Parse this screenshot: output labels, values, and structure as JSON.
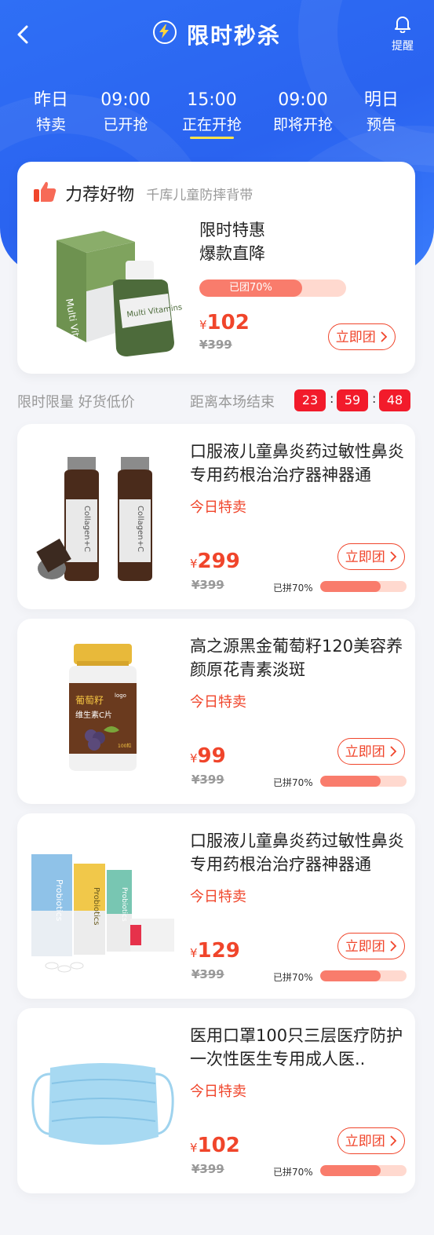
{
  "header": {
    "title": "限时秒杀",
    "remind_label": "提醒"
  },
  "tabs": [
    {
      "line1": "昨日",
      "line2": "特卖",
      "active": false
    },
    {
      "line1": "09:00",
      "line2": "已开抢",
      "active": false
    },
    {
      "line1": "15:00",
      "line2": "正在开抢",
      "active": true
    },
    {
      "line1": "09:00",
      "line2": "即将开抢",
      "active": false
    },
    {
      "line1": "明日",
      "line2": "预告",
      "active": false
    }
  ],
  "featured": {
    "title": "力荐好物",
    "subtitle": "千库儿童防摔背带",
    "slogan_line1": "限时特惠",
    "slogan_line2": "爆款直降",
    "progress_label": "已团70%",
    "progress": 0.7,
    "currency": "¥",
    "price": "102",
    "original_price": "¥399",
    "button": "立即团",
    "image_text": "Multi Vitamins"
  },
  "countdown": {
    "left_text": "限时限量 好货低价",
    "mid_text": "距离本场结束",
    "hours": "23",
    "minutes": "59",
    "seconds": "48",
    "separator": ":"
  },
  "products": [
    {
      "title": "口服液儿童鼻炎药过敏性鼻炎专用药根治治疗器神器通",
      "tag": "今日特卖",
      "currency": "¥",
      "price": "299",
      "original_price": "¥399",
      "button": "立即团",
      "sold_label": "已拼70%",
      "progress": 0.7,
      "image_text": "Collagen+C"
    },
    {
      "title": "高之源黑金葡萄籽120美容养颜原花青素淡斑",
      "tag": "今日特卖",
      "currency": "¥",
      "price": "99",
      "original_price": "¥399",
      "button": "立即团",
      "sold_label": "已拼70%",
      "progress": 0.7,
      "image_text_1": "葡萄籽",
      "image_text_2": "维生素C片",
      "image_text_3": "logo",
      "image_text_4": "100粒"
    },
    {
      "title": "口服液儿童鼻炎药过敏性鼻炎专用药根治治疗器神器通",
      "tag": "今日特卖",
      "currency": "¥",
      "price": "129",
      "original_price": "¥399",
      "button": "立即团",
      "sold_label": "已拼70%",
      "progress": 0.7,
      "image_text": "Probiotics"
    },
    {
      "title": "医用口罩100只三层医疗防护一次性医生专用成人医..",
      "tag": "今日特卖",
      "currency": "¥",
      "price": "102",
      "original_price": "¥399",
      "button": "立即团",
      "sold_label": "已拼70%",
      "progress": 0.7
    }
  ],
  "colors": {
    "primary_blue": "#2f6ff5",
    "accent_red": "#f0452b",
    "countdown_red": "#f21b2b",
    "progress_fill": "#f97c6c",
    "progress_track": "#ffd9cf",
    "tab_underline": "#ffe34a"
  }
}
